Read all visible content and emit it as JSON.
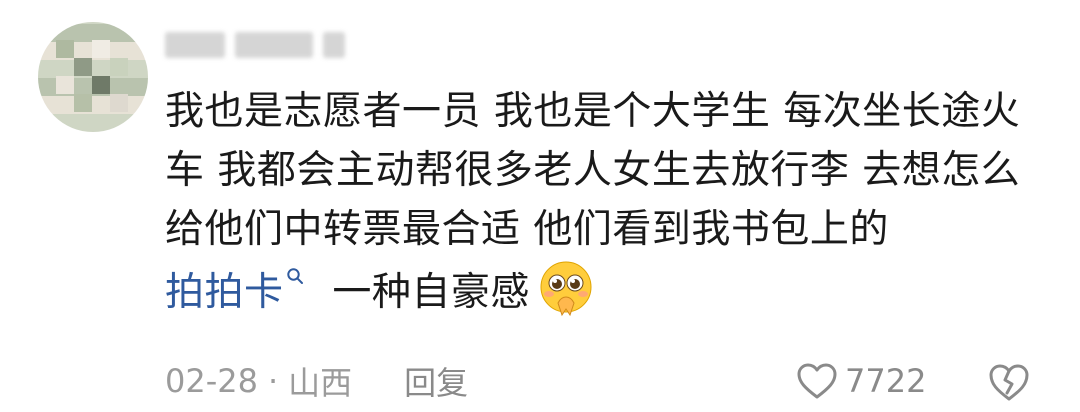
{
  "comment": {
    "text_line1": "我也是志愿者一员 我也是个大学生 每次坐长途火",
    "text_line2": "车 我都会主动帮很多老人女生去放行李 去想怎么",
    "text_line3": "给他们中转票最合适 他们看到我书包上的",
    "link_text": "拍拍卡",
    "after_link": " 一种自豪感",
    "emoji": "pleading-face-hands-emoji"
  },
  "meta": {
    "date": "02-28",
    "dot": "·",
    "location": "山西",
    "reply_label": "回复"
  },
  "actions": {
    "like_count": "7722",
    "like_icon": "heart-icon",
    "dislike_icon": "broken-heart-icon"
  },
  "colors": {
    "link": "#2f5a9e",
    "text": "#1a1a1a",
    "muted": "#9b9b9b"
  }
}
